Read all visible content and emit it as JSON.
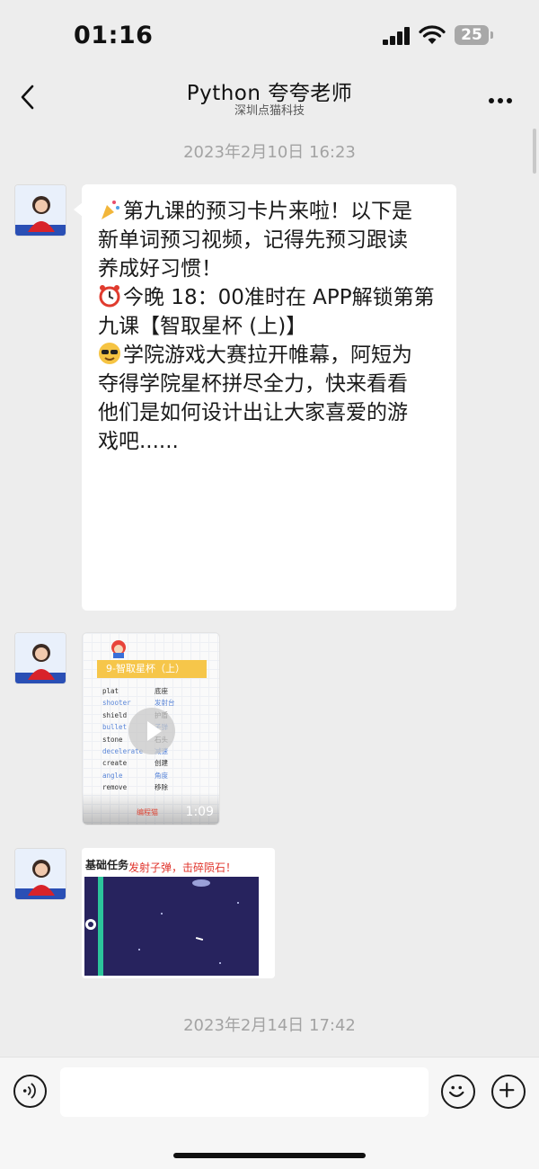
{
  "status_bar": {
    "time": "01:16",
    "battery": "25"
  },
  "header": {
    "title": "Python 夸夸老师",
    "subtitle": "深圳点猫科技"
  },
  "messages": {
    "timestamp_1": "2023年2月10日 16:23",
    "text_lines": [
      "第九课的预习卡片来啦！以下是",
      "新单词预习视频，记得先预习跟读",
      "养成好习惯！",
      "今晚 18：00准时在 APP解锁第第",
      "九课【智取星杯 (上)】",
      "学院游戏大赛拉开帷幕，阿短为",
      "夺得学院星杯拼尽全力，快来看看",
      "他们是如何设计出让大家喜爱的游",
      "戏吧......"
    ],
    "video": {
      "lesson_tag": "9-智取星杯（上）",
      "words": [
        {
          "en": "plat",
          "zh": "底座"
        },
        {
          "en": "shooter",
          "zh": "发射台"
        },
        {
          "en": "shield",
          "zh": "护盾"
        },
        {
          "en": "bullet",
          "zh": "子弹"
        },
        {
          "en": "stone",
          "zh": "石头"
        },
        {
          "en": "decelerate",
          "zh": "减速"
        },
        {
          "en": "create",
          "zh": "创建"
        },
        {
          "en": "angle",
          "zh": "角度"
        },
        {
          "en": "remove",
          "zh": "移除"
        }
      ],
      "brand": "编程猫",
      "duration": "1:09"
    },
    "task_card": {
      "label": "基础任务",
      "title": "发射子弹，击碎陨石！"
    },
    "timestamp_2": "2023年2月14日 17:42"
  },
  "input": {
    "value": "",
    "placeholder": ""
  },
  "colors": {
    "background": "#ededed",
    "bubble": "#ffffff",
    "task_title": "#e0342c",
    "lesson_tag": "#f6c64a"
  }
}
